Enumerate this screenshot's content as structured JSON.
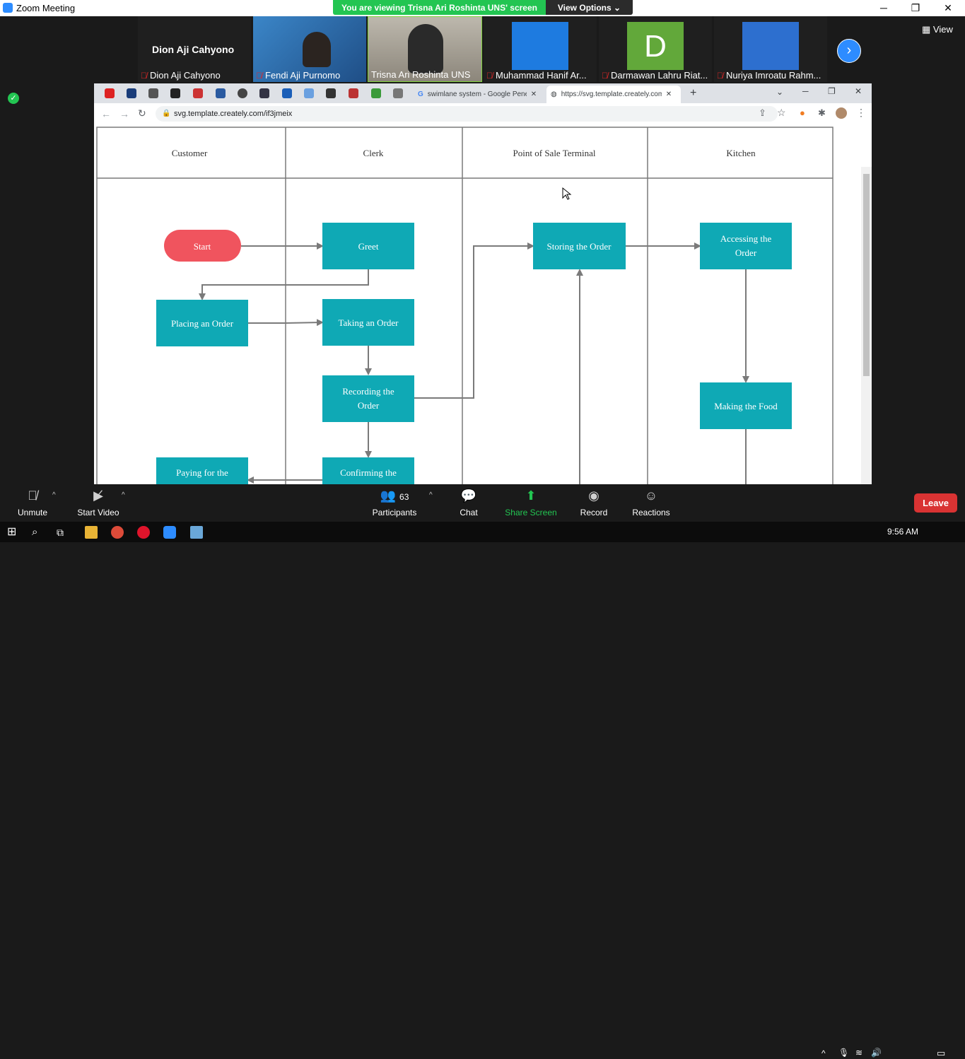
{
  "window": {
    "title": "Zoom Meeting",
    "viewing_banner": "You are viewing Trisna Ari Roshinta UNS' screen",
    "view_options": "View Options"
  },
  "participants": [
    {
      "name": "Dion Aji Cahyono",
      "display": "Dion Aji Cahyono"
    },
    {
      "name": "Fendi Aji Purnomo"
    },
    {
      "name": "Trisna Ari Roshinta UNS"
    },
    {
      "name": "Muhammad Hanif Ar..."
    },
    {
      "name": "Darmawan Lahru Riat...",
      "avatar_letter": "D"
    },
    {
      "name": "Nuriya Imroatu Rahm..."
    }
  ],
  "view_label": "View",
  "browser": {
    "tabs": [
      {
        "title": "swimlane system - Google Peneli"
      },
      {
        "title": "https://svg.template.creately.com"
      }
    ],
    "url": "svg.template.creately.com/if3jmeix"
  },
  "diagram": {
    "lanes": [
      "Customer",
      "Clerk",
      "Point of Sale Terminal",
      "Kitchen"
    ],
    "nodes": {
      "start": "Start",
      "greet": "Greet",
      "placing": "Placing an Order",
      "taking": "Taking an Order",
      "recording_1": "Recording the",
      "recording_2": "Order",
      "confirming": "Confirming the",
      "paying": "Paying for the",
      "storing": "Storing the Order",
      "accessing_1": "Accessing the",
      "accessing_2": "Order",
      "making": "Making the Food"
    },
    "colors": {
      "process": "#0fa9b5",
      "start": "#f0545e",
      "line": "#7a7a7a"
    }
  },
  "toolbar": {
    "unmute": "Unmute",
    "start_video": "Start Video",
    "participants": "Participants",
    "participants_count": "63",
    "chat": "Chat",
    "share_screen": "Share Screen",
    "record": "Record",
    "reactions": "Reactions",
    "leave": "Leave"
  },
  "taskbar": {
    "time": "9:56 AM"
  }
}
